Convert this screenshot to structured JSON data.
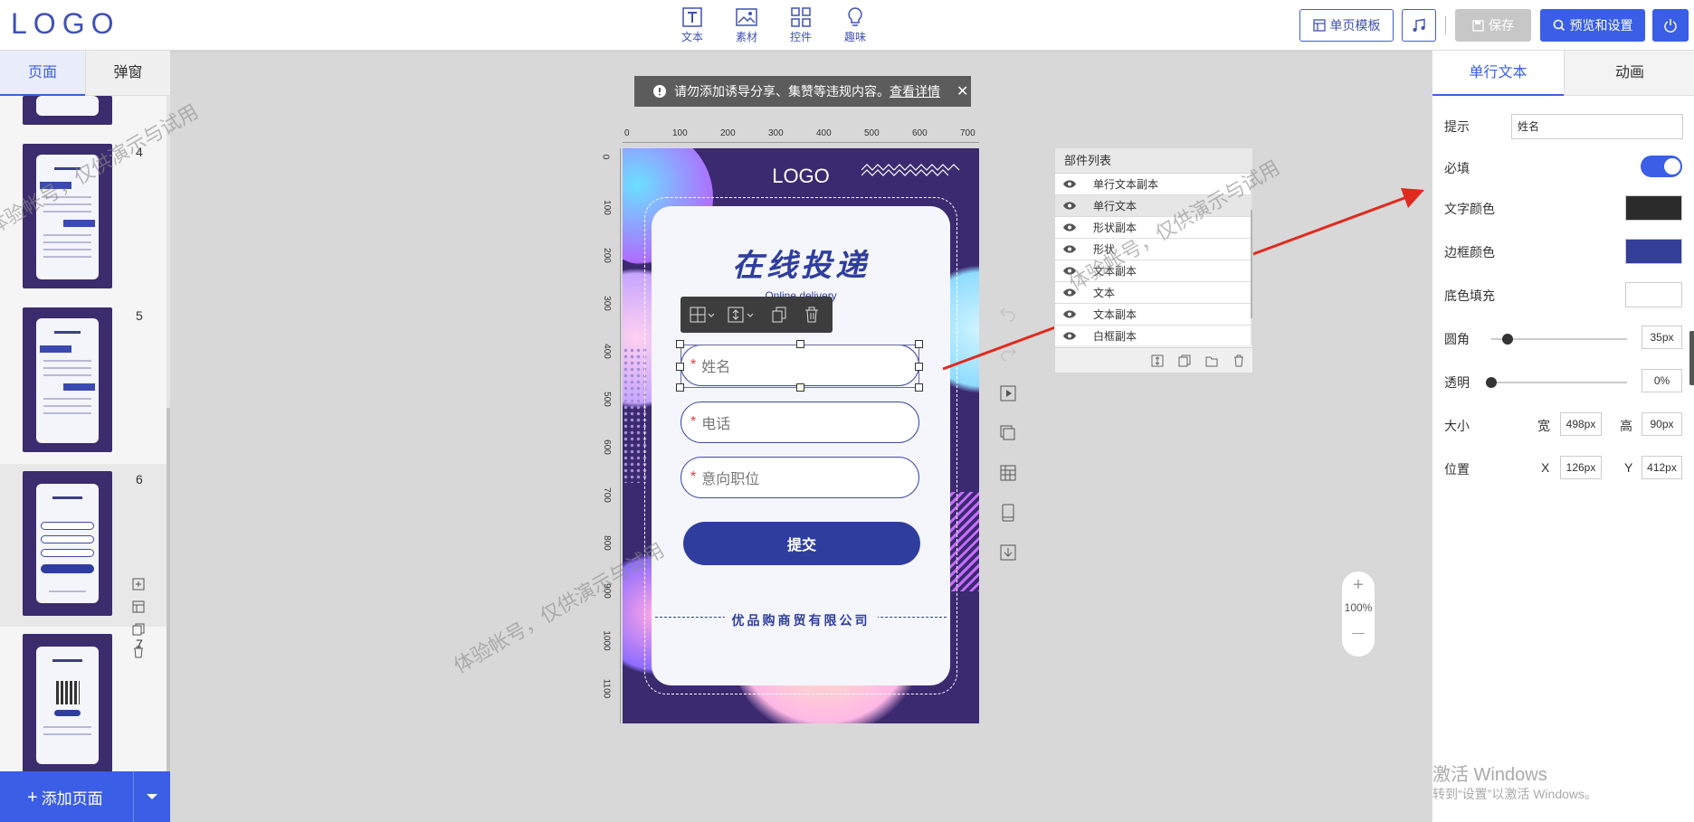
{
  "app": {
    "logo": "LOGO"
  },
  "toolbar": {
    "tools": [
      {
        "label": "文本",
        "icon": "text-icon"
      },
      {
        "label": "素材",
        "icon": "image-icon"
      },
      {
        "label": "控件",
        "icon": "widgets-icon"
      },
      {
        "label": "趣味",
        "icon": "bulb-icon"
      }
    ],
    "template_label": "单页模板",
    "save_label": "保存",
    "preview_label": "预览和设置"
  },
  "left_panel": {
    "tabs": [
      "页面",
      "弹窗"
    ],
    "pages": [
      "4",
      "5",
      "6",
      "7"
    ],
    "add_page_label": "添加页面"
  },
  "notice": {
    "text": "请勿添加诱导分享、集赞等违规内容。",
    "link": "查看详情"
  },
  "ruler": {
    "top": [
      "0",
      "100",
      "200",
      "300",
      "400",
      "500",
      "600",
      "700"
    ],
    "left": [
      "0",
      "100",
      "200",
      "300",
      "400",
      "500",
      "600",
      "700",
      "800",
      "900",
      "1000",
      "1100"
    ]
  },
  "phone": {
    "logo": "LOGO",
    "title": "在线投递",
    "subtitle": "Online delivery",
    "fields": [
      {
        "star": "*",
        "placeholder": "姓名"
      },
      {
        "star": "*",
        "placeholder": "电话"
      },
      {
        "star": "*",
        "placeholder": "意向职位"
      }
    ],
    "submit": "提交",
    "company": "优品购商贸有限公司"
  },
  "layers": {
    "title": "部件列表",
    "items": [
      "单行文本副本",
      "单行文本",
      "形状副本",
      "形状",
      "文本副本",
      "文本",
      "文本副本",
      "白框副本"
    ],
    "selected_index": 1
  },
  "zoom": {
    "plus": "+",
    "value": "100%",
    "minus": "—"
  },
  "right_panel": {
    "tabs": [
      "单行文本",
      "动画"
    ],
    "hint_label": "提示",
    "hint_value": "姓名",
    "required_label": "必填",
    "required_on": true,
    "text_color_label": "文字颜色",
    "text_color": "#2b2b2b",
    "border_color_label": "边框颜色",
    "border_color": "#333f99",
    "fill_label": "底色填充",
    "fill_color": "#ffffff",
    "radius_label": "圆角",
    "radius_value": "35px",
    "radius_fraction": 0.12,
    "opacity_label": "透明",
    "opacity_value": "0%",
    "opacity_fraction": 0,
    "size_label": "大小",
    "width_label": "宽",
    "width_value": "498px",
    "height_label": "高",
    "height_value": "90px",
    "pos_label": "位置",
    "x_label": "X",
    "x_value": "126px",
    "y_label": "Y",
    "y_value": "412px"
  },
  "watermark": {
    "text": "体验帐号，仅供演示与试用"
  },
  "windows": {
    "title": "激活 Windows",
    "sub": "转到“设置”以激活 Windows。"
  }
}
